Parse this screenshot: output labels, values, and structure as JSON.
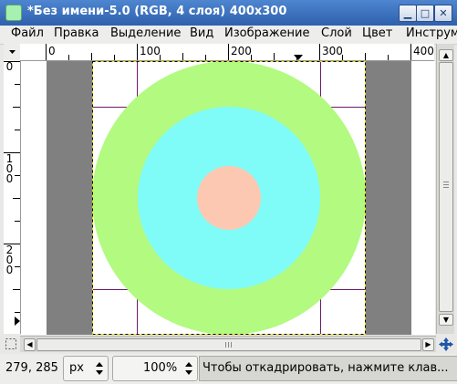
{
  "window": {
    "title": "*Без имени-5.0 (RGB, 4 слоя) 400x300",
    "minimize_glyph": "▁",
    "maximize_glyph": "□",
    "close_glyph": "✕"
  },
  "menu": [
    "Файл",
    "Правка",
    "Выделение",
    "Вид",
    "Изображение",
    "Слой",
    "Цвет",
    "Инструм"
  ],
  "ruler": {
    "h_labels": [
      "0",
      "100",
      "200",
      "300",
      "400"
    ],
    "v_labels": [
      "0",
      "100",
      "200"
    ]
  },
  "canvas": {
    "outer_circle_color": "#b2fa80",
    "middle_circle_color": "#80fcf8",
    "inner_circle_color": "#fcc8b2",
    "pasteboard_color": "#808080"
  },
  "status": {
    "coords": "279, 285",
    "unit": "px",
    "zoom": "100%",
    "message": "Чтобы откадрировать, нажмите клав..."
  }
}
